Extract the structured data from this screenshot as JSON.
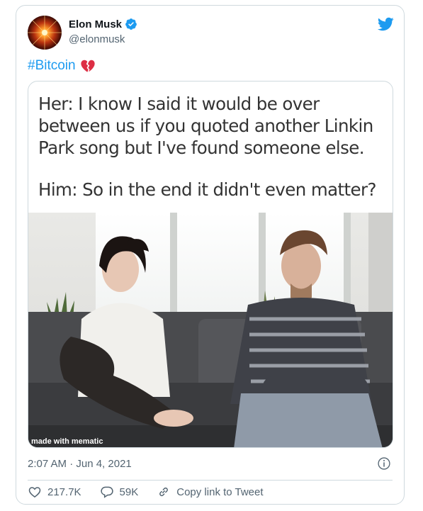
{
  "author": {
    "display_name": "Elon Musk",
    "handle": "@elonmusk"
  },
  "tweet": {
    "hashtag": "#Bitcoin",
    "emoji": "broken-heart-icon"
  },
  "meme": {
    "line1": "Her: I know I said it would be over",
    "line2": "between us if you quoted another Linkin",
    "line3": "Park song but I've found someone else.",
    "line4": "Him: So in the end it didn't even matter?",
    "watermark": "made with mematic"
  },
  "meta": {
    "timestamp": "2:07 AM · Jun 4, 2021"
  },
  "actions": {
    "likes": "217.7K",
    "replies": "59K",
    "copy_link": "Copy link to Tweet"
  },
  "colors": {
    "accent": "#1d9bf0",
    "verified": "#1d9bf0",
    "heart": "#e0245e",
    "text_secondary": "#536471"
  }
}
